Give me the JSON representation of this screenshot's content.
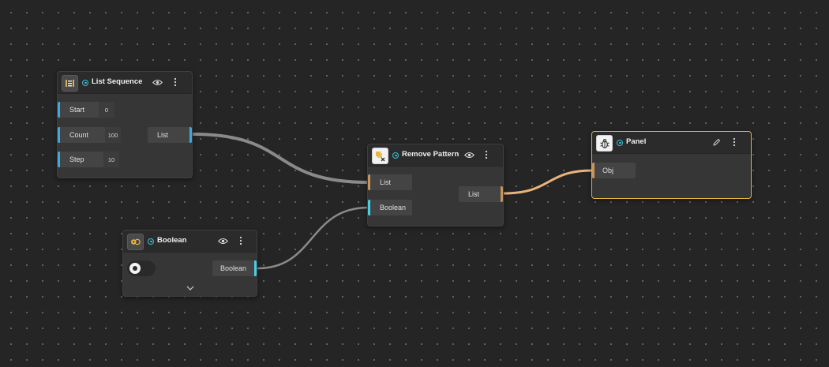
{
  "colors": {
    "canvas_bg": "#252525",
    "wire_gray": "#8a8a8a",
    "wire_orange": "#e8b47c",
    "state_cyan": "#37c2d6",
    "selected_border": "#e2b53d"
  },
  "nodes": {
    "list_sequence": {
      "title": "List Sequence",
      "icon": "list-sequence-icon",
      "inputs": [
        {
          "label": "Start",
          "value": "0"
        },
        {
          "label": "Count",
          "value": "100"
        },
        {
          "label": "Step",
          "value": "10"
        }
      ],
      "output": "List"
    },
    "boolean": {
      "title": "Boolean",
      "icon": "boolean-icon",
      "output": "Boolean",
      "toggle_state": "off"
    },
    "remove_pattern": {
      "title": "Remove Pattern",
      "icon": "remove-pattern-icon",
      "inputs": [
        {
          "label": "List"
        },
        {
          "label": "Boolean"
        }
      ],
      "output": "List"
    },
    "panel": {
      "title": "Panel",
      "icon": "panel-bug-icon",
      "inputs": [
        {
          "label": "Obj"
        }
      ],
      "selected": true
    }
  },
  "connections": [
    {
      "from": "List Sequence.List",
      "to": "Remove Pattern.List",
      "color": "gray"
    },
    {
      "from": "Boolean.Boolean",
      "to": "Remove Pattern.Boolean",
      "color": "gray"
    },
    {
      "from": "Remove Pattern.List",
      "to": "Panel.Obj",
      "color": "orange"
    }
  ]
}
